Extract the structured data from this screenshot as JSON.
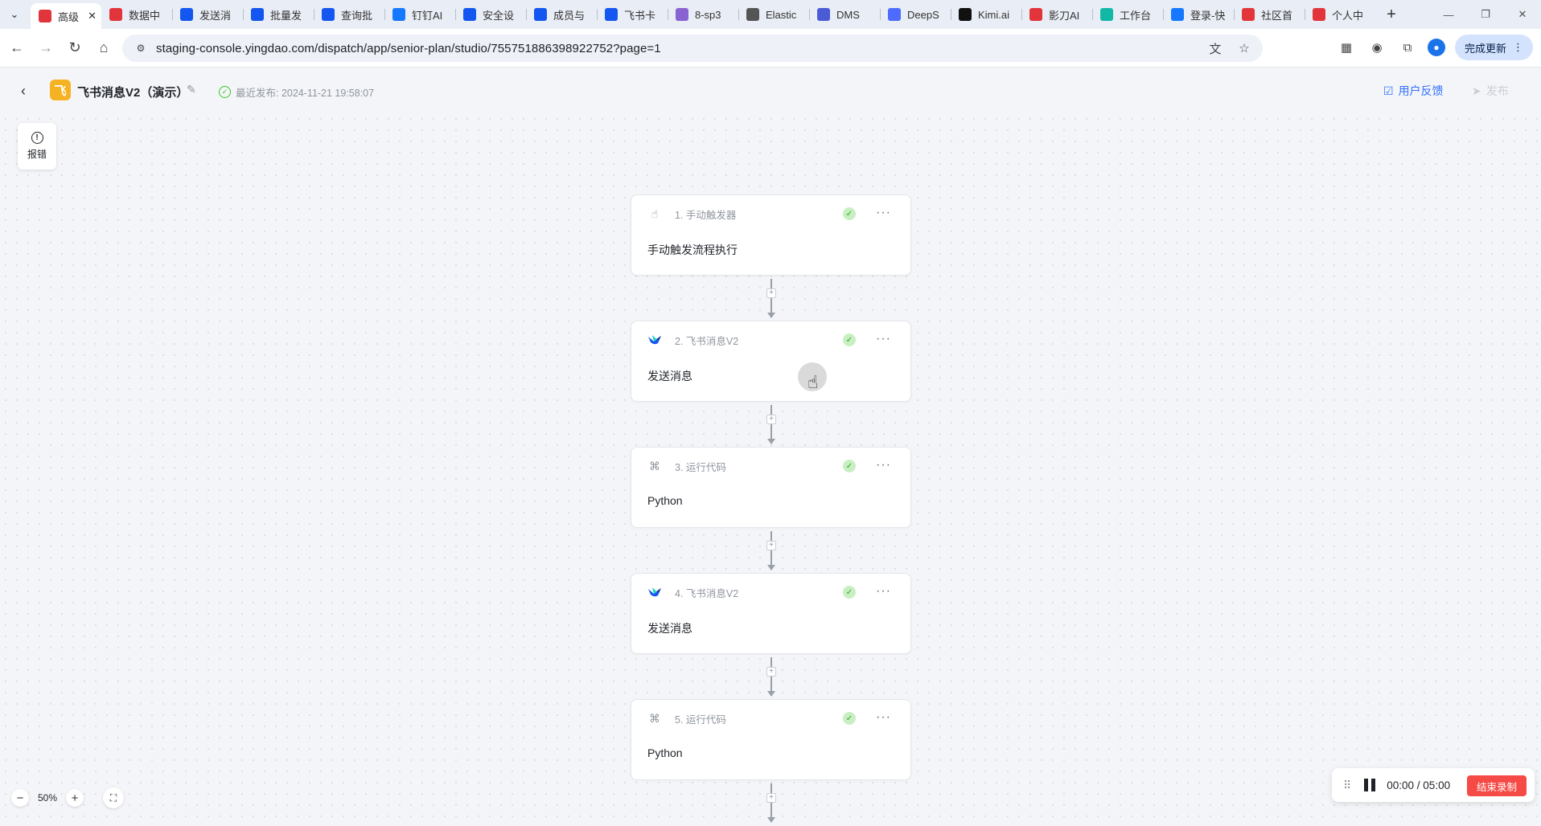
{
  "browser": {
    "tabs": [
      {
        "title": "高级",
        "icon": "yingdao-icon",
        "color": "#e2353b",
        "active": true
      },
      {
        "title": "数据中",
        "icon": "yingdao-icon",
        "color": "#e2353b"
      },
      {
        "title": "发送消",
        "icon": "feishu-icon",
        "color": "#1456f0"
      },
      {
        "title": "批量发",
        "icon": "feishu-icon",
        "color": "#1456f0"
      },
      {
        "title": "查询批",
        "icon": "feishu-icon",
        "color": "#1456f0"
      },
      {
        "title": "钉钉AI",
        "icon": "dingtalk-icon",
        "color": "#1677ff"
      },
      {
        "title": "安全设",
        "icon": "feishu-icon",
        "color": "#1456f0"
      },
      {
        "title": "成员与",
        "icon": "feishu-icon",
        "color": "#1456f0"
      },
      {
        "title": "飞书卡",
        "icon": "feishu-icon",
        "color": "#1456f0"
      },
      {
        "title": "8-sp3",
        "icon": "doc-icon",
        "color": "#8a63d2"
      },
      {
        "title": "Elastic",
        "icon": "elastic-icon",
        "color": "#555555"
      },
      {
        "title": "DMS",
        "icon": "dms-icon",
        "color": "#4b5bd6"
      },
      {
        "title": "DeepS",
        "icon": "deepseek-icon",
        "color": "#4d6bfe"
      },
      {
        "title": "Kimi.ai",
        "icon": "kimi-icon",
        "color": "#111111"
      },
      {
        "title": "影刀AI",
        "icon": "yingdao-ai-icon",
        "color": "#e2353b"
      },
      {
        "title": "工作台",
        "icon": "workbench-icon",
        "color": "#12b8a6"
      },
      {
        "title": "登录-快",
        "icon": "login-icon",
        "color": "#1677ff"
      },
      {
        "title": "社区首",
        "icon": "yingdao-icon",
        "color": "#e2353b"
      },
      {
        "title": "个人中",
        "icon": "yingdao-icon",
        "color": "#e2353b"
      }
    ],
    "url": "staging-console.yingdao.com/dispatch/app/senior-plan/studio/755751886398922752?page=1",
    "update_label": "完成更新"
  },
  "header": {
    "app_title": "飞书消息V2（演示）",
    "publish_status": "最近发布: 2024-11-21 19:58:07",
    "feedback_label": "用户反馈",
    "publish_label": "发布"
  },
  "canvas": {
    "report_label": "报错",
    "nodes": [
      {
        "label": "1. 手动触发器",
        "body": "手动触发流程执行",
        "icon": "hand-pointer-icon"
      },
      {
        "label": "2. 飞书消息V2",
        "body": "发送消息",
        "icon": "feishu-bird-icon"
      },
      {
        "label": "3. 运行代码",
        "body": "Python",
        "icon": "python-icon"
      },
      {
        "label": "4. 飞书消息V2",
        "body": "发送消息",
        "icon": "feishu-bird-icon"
      },
      {
        "label": "5. 运行代码",
        "body": "Python",
        "icon": "python-icon"
      }
    ],
    "zoom": "50%"
  },
  "recorder": {
    "time": "00:00 / 05:00",
    "stop_label": "结束录制"
  },
  "colors": {
    "accent": "#3370ff",
    "success": "#34c724",
    "danger": "#f54a45",
    "logo": "#f5b324"
  }
}
